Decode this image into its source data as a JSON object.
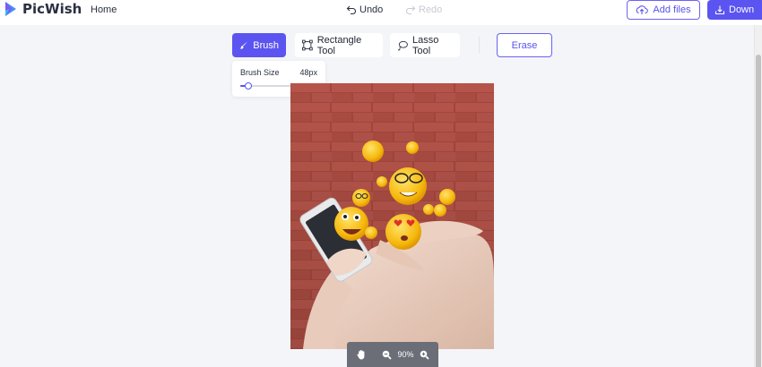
{
  "app": {
    "name": "PicWish"
  },
  "nav": {
    "home": "Home"
  },
  "history": {
    "undo": "Undo",
    "redo": "Redo"
  },
  "actions": {
    "add_files": "Add files",
    "download": "Down"
  },
  "tools": {
    "brush": "Brush",
    "rectangle": "Rectangle Tool",
    "lasso": "Lasso Tool",
    "erase": "Erase"
  },
  "brush_settings": {
    "label": "Brush Size",
    "value": "48px",
    "slider_fraction": 0.08
  },
  "zoom": {
    "level": "90%"
  },
  "colors": {
    "accent": "#5b54f0",
    "background": "#f4f5f9"
  },
  "icons": {
    "logo": "picwish-logo",
    "undo": "undo-icon",
    "redo": "redo-icon",
    "upload": "upload-icon",
    "download": "download-icon",
    "brush": "brush-icon",
    "rectangle": "rectangle-select-icon",
    "lasso": "lasso-icon",
    "hand": "hand-pan-icon",
    "zoom_out": "zoom-out-icon",
    "zoom_in": "zoom-in-icon"
  }
}
